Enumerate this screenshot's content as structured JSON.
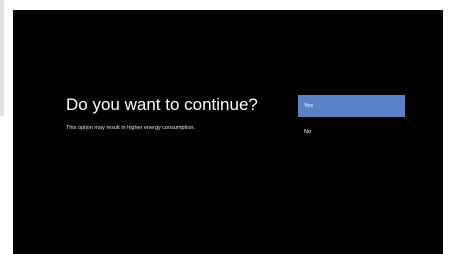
{
  "dialog": {
    "title": "Do you want to continue?",
    "message": "This option may result in higher energy consumption.",
    "options": [
      {
        "label": "Yes",
        "selected": true
      },
      {
        "label": "No",
        "selected": false
      }
    ]
  },
  "colors": {
    "screen_background": "#000000",
    "selected_option": "#5a82c8",
    "text": "#ffffff"
  }
}
